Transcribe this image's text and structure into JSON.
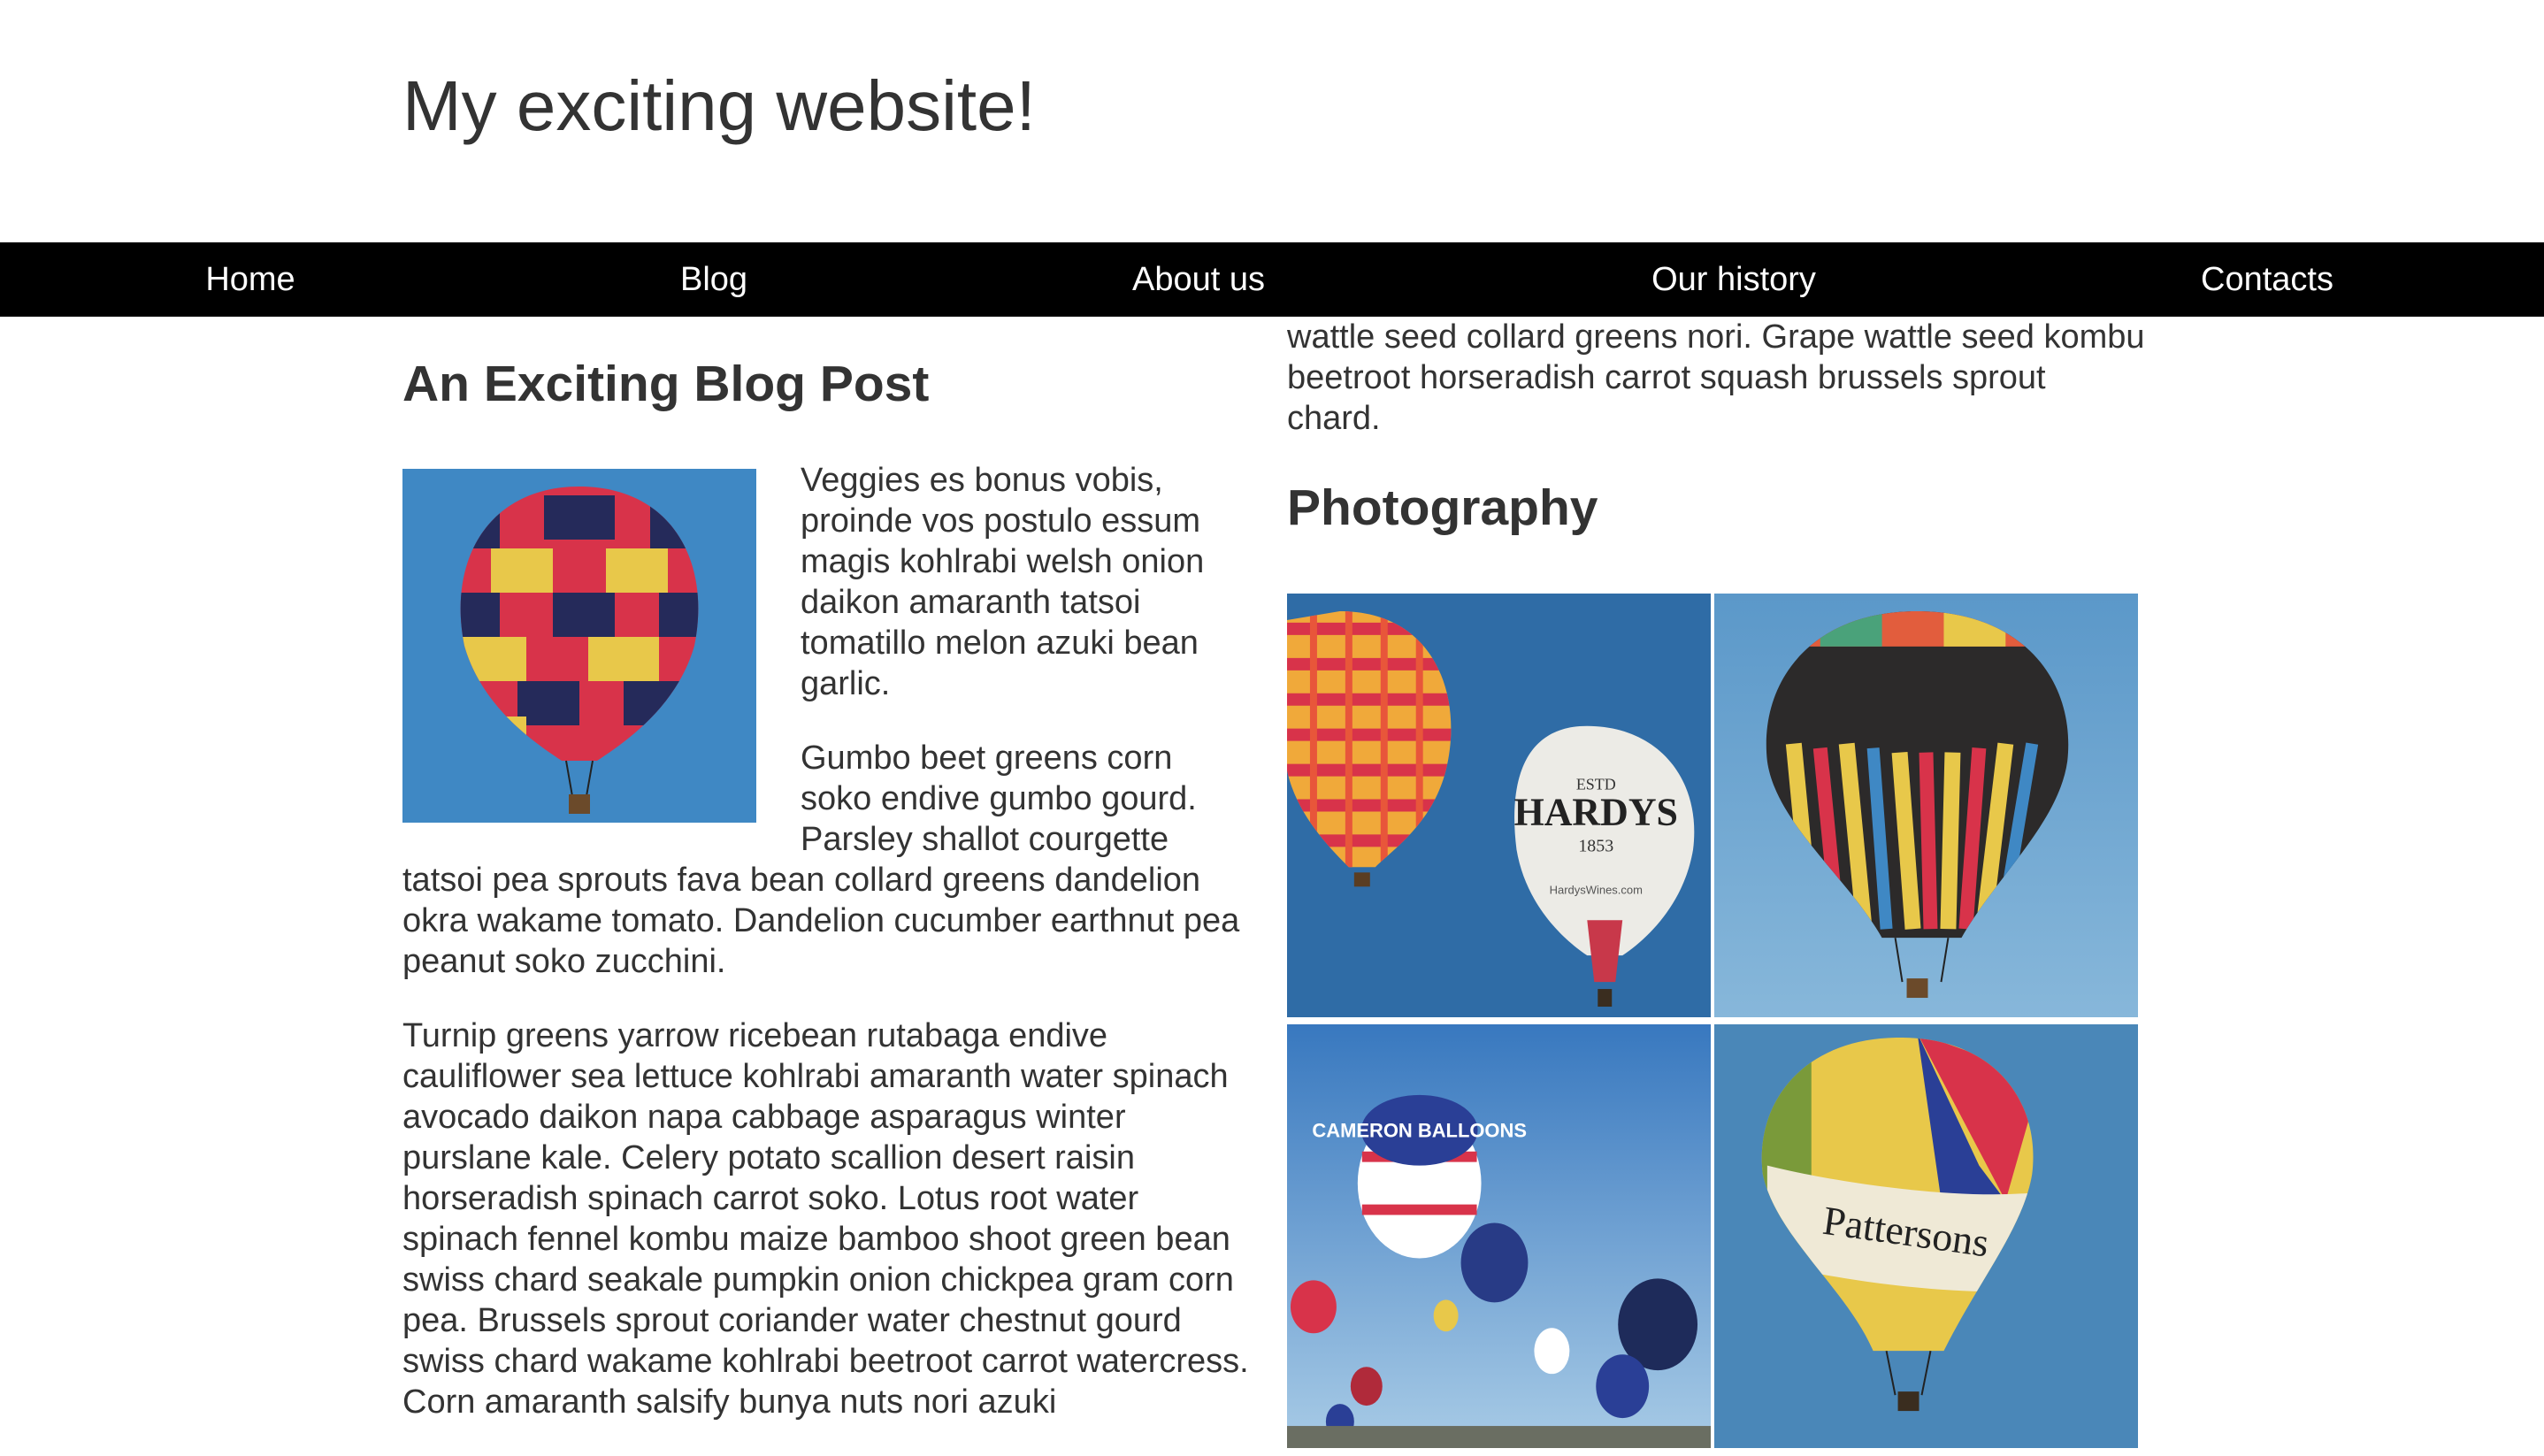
{
  "site": {
    "title": "My exciting website!"
  },
  "nav": {
    "items": [
      {
        "label": "Home"
      },
      {
        "label": "Blog"
      },
      {
        "label": "About us"
      },
      {
        "label": "Our history"
      },
      {
        "label": "Contacts"
      }
    ]
  },
  "post": {
    "title": "An Exciting Blog Post",
    "paragraphs": [
      "Veggies es bonus vobis, proinde vos postulo essum magis kohlrabi welsh onion daikon amaranth tatsoi tomatillo melon azuki bean garlic.",
      "Gumbo beet greens corn soko endive gumbo gourd. Parsley shallot courgette tatsoi pea sprouts fava bean collard greens dandelion okra wakame tomato. Dandelion cucumber earthnut pea peanut soko zucchini.",
      "Turnip greens yarrow ricebean rutabaga endive cauliflower sea lettuce kohlrabi amaranth water spinach avocado daikon napa cabbage asparagus winter purslane kale. Celery potato scallion desert raisin horseradish spinach carrot soko. Lotus root water spinach fennel kombu maize bamboo shoot green bean swiss chard seakale pumpkin onion chickpea gram corn pea. Brussels sprout coriander water chestnut gourd swiss chard wakame kohlrabi beetroot carrot watercress. Corn amaranth salsify bunya nuts nori azuki"
    ]
  },
  "sidebar": {
    "text": "wattle seed collard greens nori. Grape wattle seed kombu beetroot horseradish carrot squash brussels sprout chard."
  },
  "photography": {
    "title": "Photography",
    "balloon1": {
      "line1": "ESTD",
      "brand": "HARDYS",
      "year": "1853",
      "url": "HardysWines.com"
    },
    "balloon2": {
      "brand": "CAMERON BALLOONS"
    },
    "balloon3": {
      "brand": "Pattersons"
    }
  },
  "colors": {
    "text": "#333333",
    "nav_bg": "#000000",
    "nav_text": "#ffffff",
    "sky": "#3f88c4"
  }
}
